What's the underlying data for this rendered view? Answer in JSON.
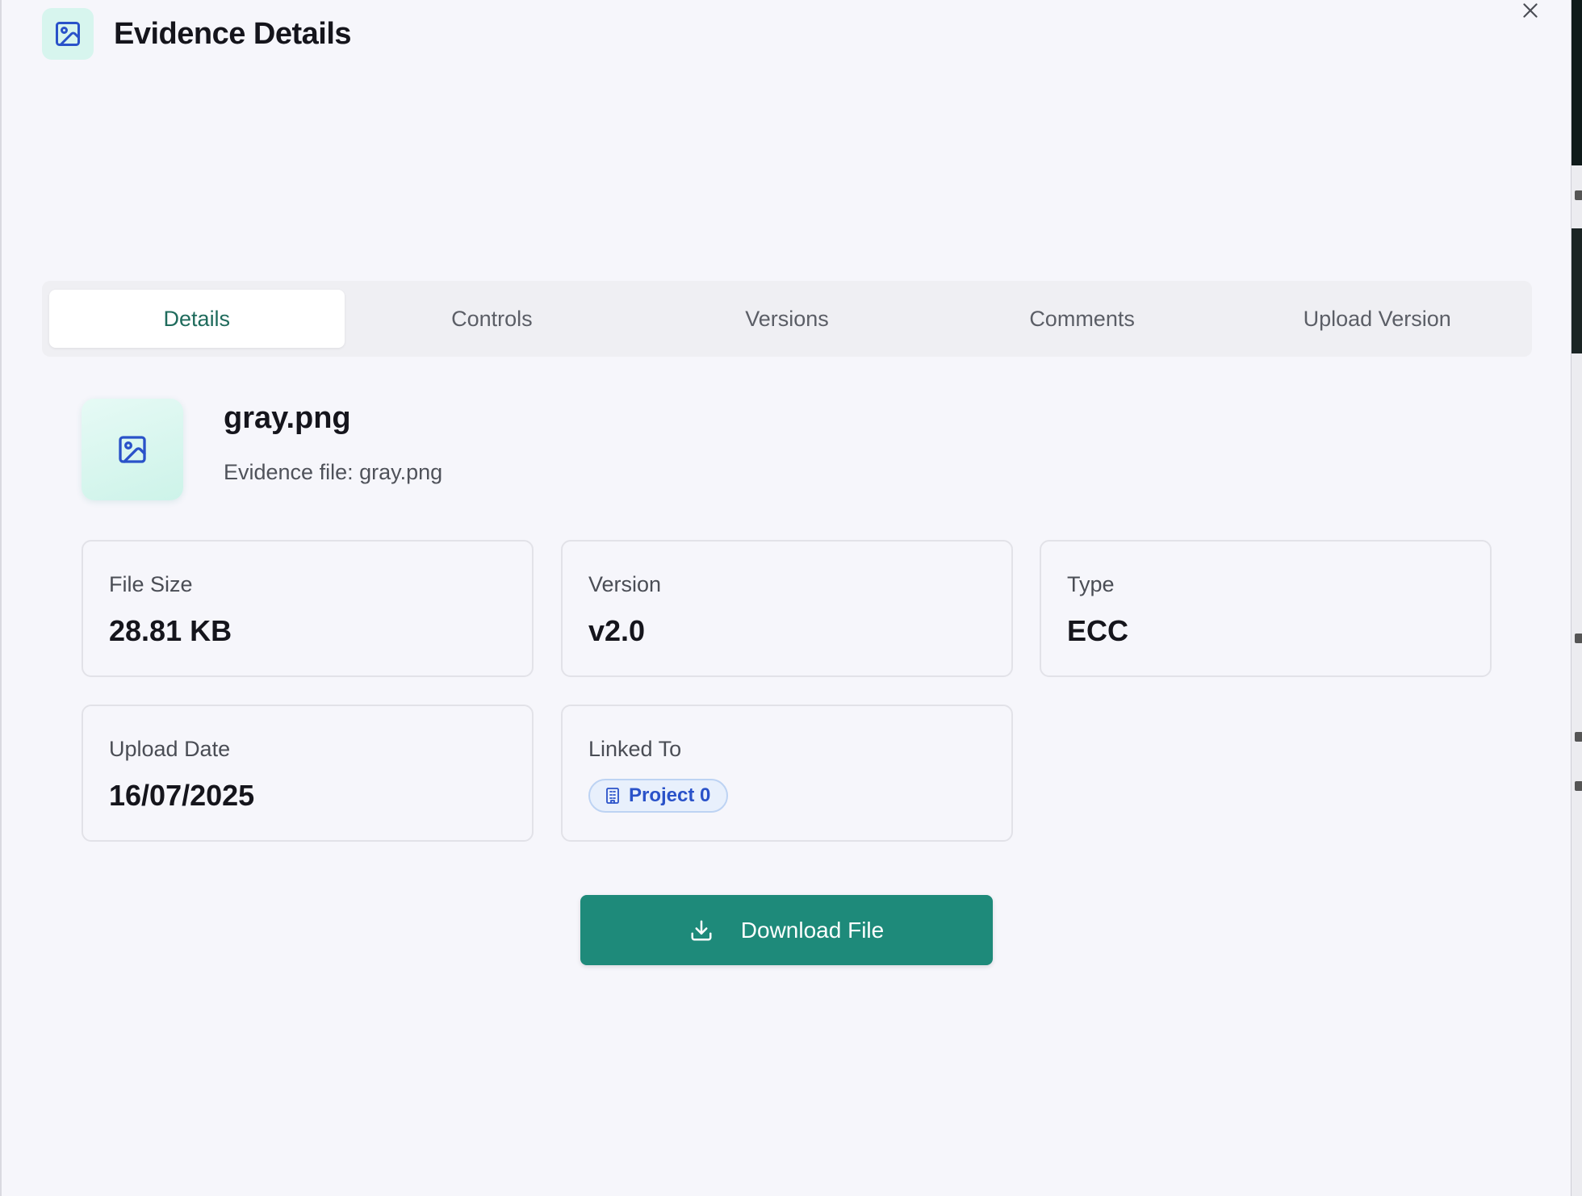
{
  "dialog": {
    "title": "Evidence Details",
    "header_icon": "image-icon",
    "close_icon": "close-icon"
  },
  "tabs": [
    {
      "label": "Details",
      "active": true
    },
    {
      "label": "Controls",
      "active": false
    },
    {
      "label": "Versions",
      "active": false
    },
    {
      "label": "Comments",
      "active": false
    },
    {
      "label": "Upload Version",
      "active": false
    }
  ],
  "file": {
    "name": "gray.png",
    "description": "Evidence file: gray.png",
    "icon": "image-icon"
  },
  "details": {
    "file_size": {
      "label": "File Size",
      "value": "28.81 KB"
    },
    "version": {
      "label": "Version",
      "value": "v2.0"
    },
    "type": {
      "label": "Type",
      "value": "ECC"
    },
    "upload_date": {
      "label": "Upload Date",
      "value": "16/07/2025"
    },
    "linked_to": {
      "label": "Linked To",
      "badge": "Project 0",
      "badge_icon": "building-icon"
    }
  },
  "actions": {
    "download_label": "Download File",
    "download_icon": "download-icon"
  },
  "colors": {
    "accent": "#1e8a7a",
    "active_tab_text": "#1f6b5c",
    "icon_blue": "#2a52c9",
    "background": "#f6f6fb"
  }
}
